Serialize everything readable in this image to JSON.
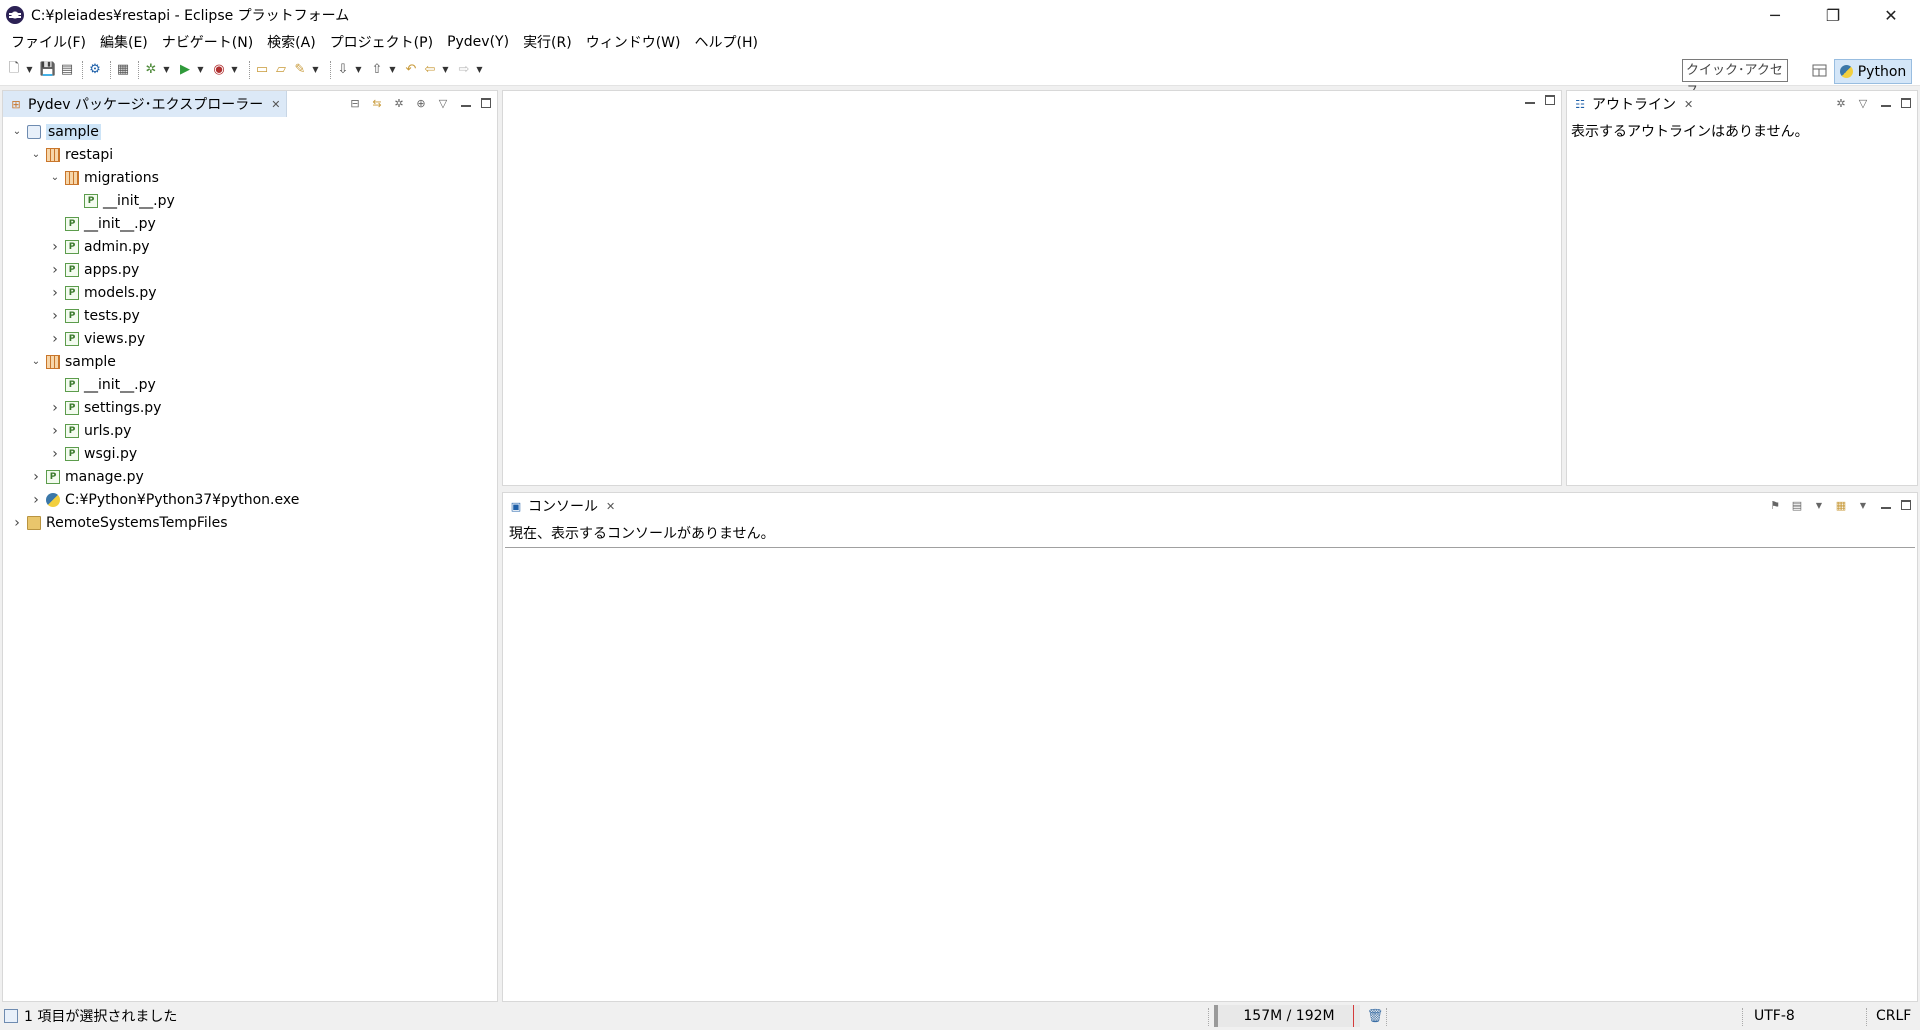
{
  "window": {
    "title": "C:¥pleiades¥restapi - Eclipse プラットフォーム",
    "controls": {
      "minimize": "─",
      "restore": "❐",
      "close": "✕"
    }
  },
  "menu": [
    "ファイル(F)",
    "編集(E)",
    "ナビゲート(N)",
    "検索(A)",
    "プロジェクト(P)",
    "Pydev(Y)",
    "実行(R)",
    "ウィンドウ(W)",
    "ヘルプ(H)"
  ],
  "toolbar": {
    "quick_access": "クイック･アクセス",
    "perspective": "Python",
    "icons": [
      "new-icon",
      "save-icon",
      "save-all-icon",
      "settings-icon",
      "open-perspective-icon",
      "debug-icon",
      "run-icon",
      "external-tools-icon",
      "open-type-icon",
      "open-resource-icon",
      "search-icon",
      "next-annotation-icon",
      "prev-annotation-icon",
      "last-edit-icon",
      "back-icon",
      "forward-icon"
    ]
  },
  "explorer": {
    "tab_label": "Pydev パッケージ･エクスプローラー",
    "tree": [
      {
        "label": "sample",
        "icon": "project-icon",
        "depth": 0,
        "twisty": "expanded",
        "selected": true
      },
      {
        "label": "restapi",
        "icon": "package-icon",
        "depth": 1,
        "twisty": "expanded"
      },
      {
        "label": "migrations",
        "icon": "package-icon",
        "depth": 2,
        "twisty": "expanded"
      },
      {
        "label": "__init__.py",
        "icon": "python-file-icon",
        "depth": 3,
        "twisty": "none"
      },
      {
        "label": "__init__.py",
        "icon": "python-file-icon",
        "depth": 2,
        "twisty": "none"
      },
      {
        "label": "admin.py",
        "icon": "python-file-icon",
        "depth": 2,
        "twisty": "collapsed"
      },
      {
        "label": "apps.py",
        "icon": "python-file-icon",
        "depth": 2,
        "twisty": "collapsed"
      },
      {
        "label": "models.py",
        "icon": "python-file-icon",
        "depth": 2,
        "twisty": "collapsed"
      },
      {
        "label": "tests.py",
        "icon": "python-file-icon",
        "depth": 2,
        "twisty": "collapsed"
      },
      {
        "label": "views.py",
        "icon": "python-file-icon",
        "depth": 2,
        "twisty": "collapsed"
      },
      {
        "label": "sample",
        "icon": "package-icon",
        "depth": 1,
        "twisty": "expanded"
      },
      {
        "label": "__init__.py",
        "icon": "python-file-icon",
        "depth": 2,
        "twisty": "none"
      },
      {
        "label": "settings.py",
        "icon": "python-file-icon",
        "depth": 2,
        "twisty": "collapsed"
      },
      {
        "label": "urls.py",
        "icon": "python-file-icon",
        "depth": 2,
        "twisty": "collapsed"
      },
      {
        "label": "wsgi.py",
        "icon": "python-file-icon",
        "depth": 2,
        "twisty": "collapsed"
      },
      {
        "label": "manage.py",
        "icon": "python-file-icon",
        "depth": 1,
        "twisty": "collapsed"
      },
      {
        "label": "C:¥Python¥Python37¥python.exe",
        "icon": "python-interpreter-icon",
        "depth": 1,
        "twisty": "collapsed"
      },
      {
        "label": "RemoteSystemsTempFiles",
        "icon": "folder-project-icon",
        "depth": 0,
        "twisty": "collapsed"
      }
    ]
  },
  "outline": {
    "tab_label": "アウトライン",
    "message": "表示するアウトラインはありません。"
  },
  "console": {
    "tab_label": "コンソール",
    "message": "現在、表示するコンソールがありません。"
  },
  "status": {
    "selection": "1 項目が選択されました",
    "heap": "157M / 192M",
    "encoding": "UTF-8",
    "line_ending": "CRLF"
  },
  "colors": {
    "selection": "#cde4f7",
    "active_tab": "#dce9f7",
    "perspective_button": "#d4e6f8"
  }
}
